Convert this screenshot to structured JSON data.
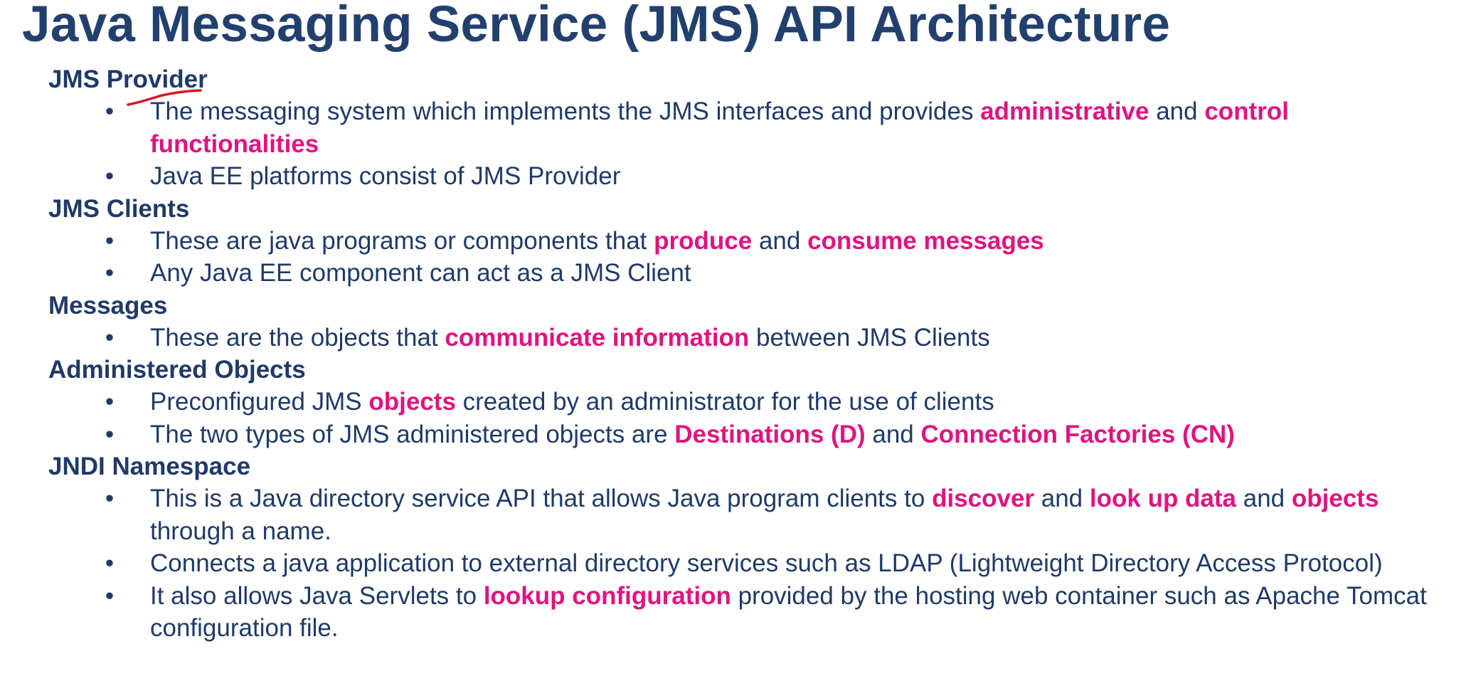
{
  "title": "Java Messaging Service (JMS) API Architecture",
  "bullet_char": "•",
  "colors": {
    "text": "#1f3a68",
    "highlight": "#e0137f",
    "pen": "#d8131f"
  },
  "sections": [
    {
      "heading": "JMS Provider",
      "bullets": [
        [
          {
            "t": "The messaging system which implements the JMS interfaces and provides "
          },
          {
            "t": "administrative",
            "hl": true
          },
          {
            "t": " and "
          },
          {
            "t": "control functionalities",
            "hl": true
          }
        ],
        [
          {
            "t": "Java EE platforms consist of JMS Provider"
          }
        ]
      ]
    },
    {
      "heading": "JMS Clients",
      "bullets": [
        [
          {
            "t": "These are java programs or components that "
          },
          {
            "t": "produce",
            "hl": true
          },
          {
            "t": " and "
          },
          {
            "t": "consume messages",
            "hl": true
          }
        ],
        [
          {
            "t": "Any Java EE component can act as a JMS Client"
          }
        ]
      ]
    },
    {
      "heading": "Messages",
      "bullets": [
        [
          {
            "t": "These are the objects that "
          },
          {
            "t": "communicate information",
            "hl": true
          },
          {
            "t": " between JMS Clients"
          }
        ]
      ]
    },
    {
      "heading": "Administered Objects",
      "bullets": [
        [
          {
            "t": "Preconfigured JMS "
          },
          {
            "t": "objects",
            "hl": true
          },
          {
            "t": " created by an administrator for the use of clients"
          }
        ],
        [
          {
            "t": "The two types of JMS administered objects are "
          },
          {
            "t": "Destinations (D)",
            "hl": true
          },
          {
            "t": " and "
          },
          {
            "t": "Connection Factories (CN)",
            "hl": true
          }
        ]
      ]
    },
    {
      "heading": "JNDI Namespace",
      "bullets": [
        [
          {
            "t": "This is a Java directory service API that allows Java program clients to "
          },
          {
            "t": "discover",
            "hl": true
          },
          {
            "t": " and "
          },
          {
            "t": "look up data",
            "hl": true
          },
          {
            "t": " and "
          },
          {
            "t": "objects",
            "hl": true
          },
          {
            "t": " through a name."
          }
        ],
        [
          {
            "t": "Connects a java application to external directory services such as LDAP (Lightweight Directory Access Protocol)"
          }
        ],
        [
          {
            "t": "It also allows Java Servlets to "
          },
          {
            "t": "lookup configuration",
            "hl": true
          },
          {
            "t": " provided by the hosting web container such as Apache Tomcat configuration file."
          }
        ]
      ]
    }
  ]
}
